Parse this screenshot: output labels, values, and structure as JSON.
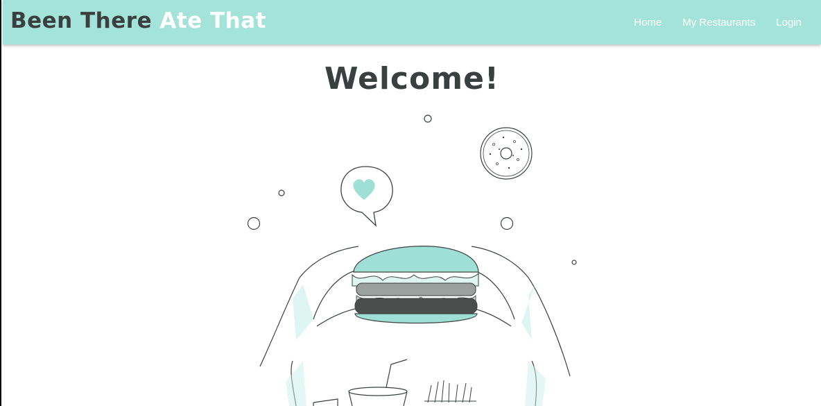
{
  "brand": {
    "part1": "Been There",
    "part2": "Ate That"
  },
  "nav": {
    "items": [
      {
        "label": "Home"
      },
      {
        "label": "My Restaurants"
      },
      {
        "label": "Login"
      }
    ]
  },
  "main": {
    "heading": "Welcome!"
  },
  "colors": {
    "navbar": "#a4e3da",
    "accent": "#9fe0d6",
    "text_dark": "#3a403f"
  },
  "illustration": {
    "icon_name": "burger-hands-illustration"
  }
}
